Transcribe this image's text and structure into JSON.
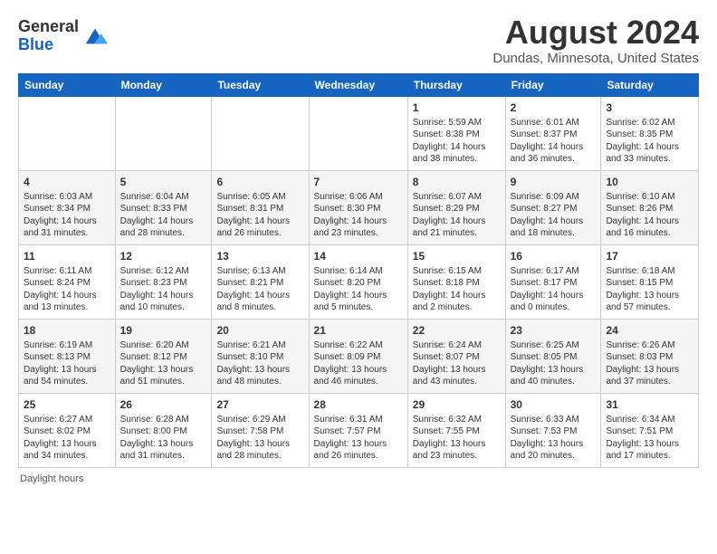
{
  "logo": {
    "general": "General",
    "blue": "Blue"
  },
  "header": {
    "title": "August 2024",
    "subtitle": "Dundas, Minnesota, United States"
  },
  "calendar": {
    "columns": [
      "Sunday",
      "Monday",
      "Tuesday",
      "Wednesday",
      "Thursday",
      "Friday",
      "Saturday"
    ],
    "weeks": [
      [
        {
          "day": "",
          "content": ""
        },
        {
          "day": "",
          "content": ""
        },
        {
          "day": "",
          "content": ""
        },
        {
          "day": "",
          "content": ""
        },
        {
          "day": "1",
          "content": "Sunrise: 5:59 AM\nSunset: 8:38 PM\nDaylight: 14 hours and 38 minutes."
        },
        {
          "day": "2",
          "content": "Sunrise: 6:01 AM\nSunset: 8:37 PM\nDaylight: 14 hours and 36 minutes."
        },
        {
          "day": "3",
          "content": "Sunrise: 6:02 AM\nSunset: 8:35 PM\nDaylight: 14 hours and 33 minutes."
        }
      ],
      [
        {
          "day": "4",
          "content": "Sunrise: 6:03 AM\nSunset: 8:34 PM\nDaylight: 14 hours and 31 minutes."
        },
        {
          "day": "5",
          "content": "Sunrise: 6:04 AM\nSunset: 8:33 PM\nDaylight: 14 hours and 28 minutes."
        },
        {
          "day": "6",
          "content": "Sunrise: 6:05 AM\nSunset: 8:31 PM\nDaylight: 14 hours and 26 minutes."
        },
        {
          "day": "7",
          "content": "Sunrise: 6:06 AM\nSunset: 8:30 PM\nDaylight: 14 hours and 23 minutes."
        },
        {
          "day": "8",
          "content": "Sunrise: 6:07 AM\nSunset: 8:29 PM\nDaylight: 14 hours and 21 minutes."
        },
        {
          "day": "9",
          "content": "Sunrise: 6:09 AM\nSunset: 8:27 PM\nDaylight: 14 hours and 18 minutes."
        },
        {
          "day": "10",
          "content": "Sunrise: 6:10 AM\nSunset: 8:26 PM\nDaylight: 14 hours and 16 minutes."
        }
      ],
      [
        {
          "day": "11",
          "content": "Sunrise: 6:11 AM\nSunset: 8:24 PM\nDaylight: 14 hours and 13 minutes."
        },
        {
          "day": "12",
          "content": "Sunrise: 6:12 AM\nSunset: 8:23 PM\nDaylight: 14 hours and 10 minutes."
        },
        {
          "day": "13",
          "content": "Sunrise: 6:13 AM\nSunset: 8:21 PM\nDaylight: 14 hours and 8 minutes."
        },
        {
          "day": "14",
          "content": "Sunrise: 6:14 AM\nSunset: 8:20 PM\nDaylight: 14 hours and 5 minutes."
        },
        {
          "day": "15",
          "content": "Sunrise: 6:15 AM\nSunset: 8:18 PM\nDaylight: 14 hours and 2 minutes."
        },
        {
          "day": "16",
          "content": "Sunrise: 6:17 AM\nSunset: 8:17 PM\nDaylight: 14 hours and 0 minutes."
        },
        {
          "day": "17",
          "content": "Sunrise: 6:18 AM\nSunset: 8:15 PM\nDaylight: 13 hours and 57 minutes."
        }
      ],
      [
        {
          "day": "18",
          "content": "Sunrise: 6:19 AM\nSunset: 8:13 PM\nDaylight: 13 hours and 54 minutes."
        },
        {
          "day": "19",
          "content": "Sunrise: 6:20 AM\nSunset: 8:12 PM\nDaylight: 13 hours and 51 minutes."
        },
        {
          "day": "20",
          "content": "Sunrise: 6:21 AM\nSunset: 8:10 PM\nDaylight: 13 hours and 48 minutes."
        },
        {
          "day": "21",
          "content": "Sunrise: 6:22 AM\nSunset: 8:09 PM\nDaylight: 13 hours and 46 minutes."
        },
        {
          "day": "22",
          "content": "Sunrise: 6:24 AM\nSunset: 8:07 PM\nDaylight: 13 hours and 43 minutes."
        },
        {
          "day": "23",
          "content": "Sunrise: 6:25 AM\nSunset: 8:05 PM\nDaylight: 13 hours and 40 minutes."
        },
        {
          "day": "24",
          "content": "Sunrise: 6:26 AM\nSunset: 8:03 PM\nDaylight: 13 hours and 37 minutes."
        }
      ],
      [
        {
          "day": "25",
          "content": "Sunrise: 6:27 AM\nSunset: 8:02 PM\nDaylight: 13 hours and 34 minutes."
        },
        {
          "day": "26",
          "content": "Sunrise: 6:28 AM\nSunset: 8:00 PM\nDaylight: 13 hours and 31 minutes."
        },
        {
          "day": "27",
          "content": "Sunrise: 6:29 AM\nSunset: 7:58 PM\nDaylight: 13 hours and 28 minutes."
        },
        {
          "day": "28",
          "content": "Sunrise: 6:31 AM\nSunset: 7:57 PM\nDaylight: 13 hours and 26 minutes."
        },
        {
          "day": "29",
          "content": "Sunrise: 6:32 AM\nSunset: 7:55 PM\nDaylight: 13 hours and 23 minutes."
        },
        {
          "day": "30",
          "content": "Sunrise: 6:33 AM\nSunset: 7:53 PM\nDaylight: 13 hours and 20 minutes."
        },
        {
          "day": "31",
          "content": "Sunrise: 6:34 AM\nSunset: 7:51 PM\nDaylight: 13 hours and 17 minutes."
        }
      ]
    ]
  },
  "footer": {
    "text": "Daylight hours"
  }
}
